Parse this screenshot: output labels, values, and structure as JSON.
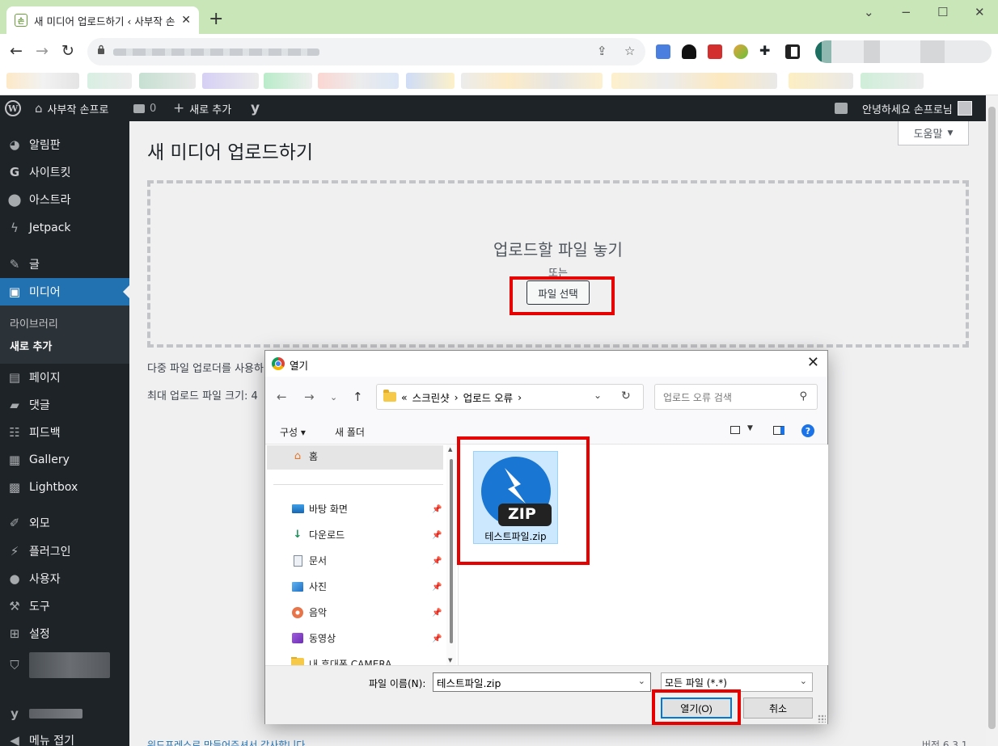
{
  "browser": {
    "tab_title": "새 미디어 업로드하기 ‹ 사부작 손",
    "tab_favicon": "손",
    "new_tab": "+",
    "tab_close": "✕",
    "window_minimize": "−",
    "window_maximize": "☐",
    "window_close": "✕",
    "chevron": "⌄"
  },
  "adminbar": {
    "site_name": "사부작 손프로",
    "comments_count": "0",
    "new_label": "새로 추가",
    "greeting": "안녕하세요 손프로님",
    "yoast": "y"
  },
  "sidebar": {
    "items": [
      {
        "label": "알림판",
        "icon": "dashboard-icon"
      },
      {
        "label": "사이트킷",
        "icon": "sitekit-icon"
      },
      {
        "label": "아스트라",
        "icon": "astra-icon"
      },
      {
        "label": "Jetpack",
        "icon": "jetpack-icon"
      },
      {
        "label": "글",
        "icon": "pin-icon"
      },
      {
        "label": "미디어",
        "icon": "media-icon"
      },
      {
        "label": "페이지",
        "icon": "page-icon"
      },
      {
        "label": "댓글",
        "icon": "comment-icon"
      },
      {
        "label": "피드백",
        "icon": "feedback-icon"
      },
      {
        "label": "Gallery",
        "icon": "gallery-icon"
      },
      {
        "label": "Lightbox",
        "icon": "lightbox-icon"
      },
      {
        "label": "외모",
        "icon": "brush-icon"
      },
      {
        "label": "플러그인",
        "icon": "plugin-icon"
      },
      {
        "label": "사용자",
        "icon": "user-icon"
      },
      {
        "label": "도구",
        "icon": "wrench-icon"
      },
      {
        "label": "설정",
        "icon": "settings-icon"
      },
      {
        "label": "메뉴 접기",
        "icon": "collapse-icon"
      }
    ],
    "submenu": [
      "라이브러리",
      "새로 추가"
    ]
  },
  "main": {
    "help_label": "도움말",
    "help_caret": "▼",
    "title": "새 미디어 업로드하기",
    "drop_text": "업로드할 파일 놓기",
    "or_text": "또는",
    "select_button": "파일 선택",
    "info_multi": "다중 파일 업로더를 사용하",
    "info_max": "최대 업로드 파일 크기: 4",
    "footer_left": "워드프레스로 만들어주셔서 감사합니다",
    "footer_right": "버전 6.3.1"
  },
  "dialog": {
    "title": "열기",
    "close": "✕",
    "breadcrumb": [
      "«",
      "스크린샷",
      "›",
      "업로드 오류",
      "›"
    ],
    "search_placeholder": "업로드 오류 검색",
    "organize": "구성 ▾",
    "new_folder": "새 폴더",
    "help": "?",
    "home": "홈",
    "nav_items": [
      {
        "label": "바탕 화면",
        "icon": "desktop-icon"
      },
      {
        "label": "다운로드",
        "icon": "download-icon"
      },
      {
        "label": "문서",
        "icon": "document-icon"
      },
      {
        "label": "사진",
        "icon": "picture-icon"
      },
      {
        "label": "음악",
        "icon": "music-icon"
      },
      {
        "label": "동영상",
        "icon": "video-icon"
      },
      {
        "label": "내 휴대폰 CAMERA",
        "icon": "folder-icon"
      }
    ],
    "file": {
      "name": "테스트파일.zip",
      "badge": "ZIP"
    },
    "filename_label": "파일 이름(N):",
    "filename_value": "테스트파일.zip",
    "filter_value": "모든 파일 (*.*)",
    "open_button": "열기(O)",
    "cancel_button": "취소"
  },
  "colors": {
    "wp_dark": "#1d2327",
    "wp_blue": "#2271b1",
    "highlight_red": "#e60000",
    "tab_bar": "#c8e6b7",
    "zip_blue": "#1976d2"
  }
}
